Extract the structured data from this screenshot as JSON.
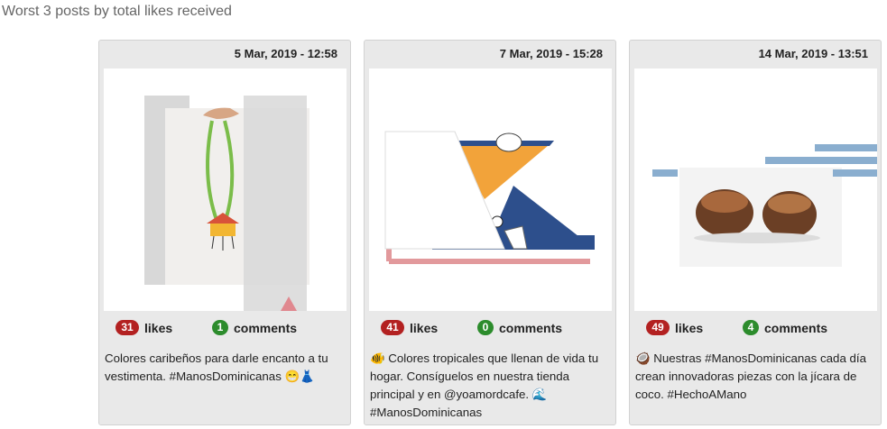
{
  "section": {
    "title": "Worst 3 posts by total likes received"
  },
  "posts": [
    {
      "date": "5 Mar, 2019 - 12:58",
      "likes": "31",
      "likes_label": "likes",
      "comments": "1",
      "comments_label": "comments",
      "caption": "Colores caribeños para darle encanto a tu vestimenta. #ManosDominicanas 😁👗"
    },
    {
      "date": "7 Mar, 2019 - 15:28",
      "likes": "41",
      "likes_label": "likes",
      "comments": "0",
      "comments_label": "comments",
      "caption": "🐠 Colores tropicales que llenan de vida tu hogar. Consíguelos en nuestra tienda principal y en @yoamordcafe. 🌊#ManosDominicanas"
    },
    {
      "date": "14 Mar, 2019 - 13:51",
      "likes": "49",
      "likes_label": "likes",
      "comments": "4",
      "comments_label": "comments",
      "caption": "🥥 Nuestras #ManosDominicanas cada día crean innovadoras piezas con la jícara de coco. #HechoAMano"
    }
  ],
  "colors": {
    "likes_badge": "#b32121",
    "comments_badge": "#2c8c2c",
    "card_bg": "#e9e9e9"
  }
}
